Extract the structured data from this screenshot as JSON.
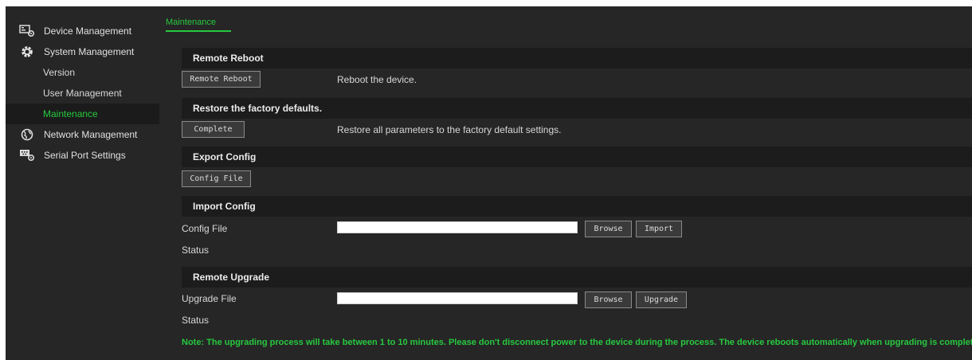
{
  "sidebar": {
    "device_management": "Device Management",
    "system_management": "System Management",
    "sub_items": {
      "version": "Version",
      "user_management": "User Management",
      "maintenance": "Maintenance"
    },
    "network_management": "Network Management",
    "serial_port_settings": "Serial Port Settings"
  },
  "tabs": {
    "maintenance": "Maintenance"
  },
  "sections": {
    "remote_reboot": {
      "title": "Remote Reboot",
      "button": "Remote Reboot",
      "description": "Reboot the device."
    },
    "restore_defaults": {
      "title": "Restore the factory defaults.",
      "button": "Complete",
      "description": "Restore all parameters to the factory default settings."
    },
    "export_config": {
      "title": "Export Config",
      "button": "Config File"
    },
    "import_config": {
      "title": "Import Config",
      "file_label": "Config File",
      "file_value": "",
      "browse": "Browse",
      "import": "Import",
      "status_label": "Status"
    },
    "remote_upgrade": {
      "title": "Remote Upgrade",
      "file_label": "Upgrade File",
      "file_value": "",
      "browse": "Browse",
      "upgrade": "Upgrade",
      "status_label": "Status",
      "note": "Note: The upgrading process will take between 1 to 10 minutes. Please don't disconnect power to the device during the process. The device reboots automatically when upgrading is completed."
    }
  },
  "colors": {
    "accent": "#27c93f",
    "background": "#262626",
    "section_bar": "#1c1c1c"
  }
}
